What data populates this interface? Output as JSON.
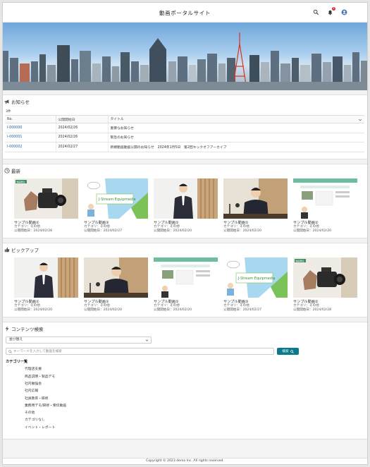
{
  "header": {
    "site_title": "動画ポータルサイト",
    "notif_count": "1",
    "icons": [
      "search-icon",
      "bell-icon",
      "user-icon"
    ]
  },
  "news": {
    "title": "お知らせ",
    "count": "3件",
    "columns": {
      "no": "No.",
      "date": "公開開始日",
      "title": "タイトル"
    },
    "rows": [
      {
        "no": "I-000000",
        "date": "2024/02/26",
        "title": "重要なお知らせ"
      },
      {
        "no": "I-000001",
        "date": "2024/02/26",
        "title": "緊急のお知らせ"
      },
      {
        "no": "I-000002",
        "date": "2024/02/27",
        "title": "新規動画動画公開のお知らせ　2024年1月5日　第2回キックオフアーカイブ"
      }
    ]
  },
  "latest": {
    "title": "最新",
    "items": [
      {
        "name": "サンプル動画②",
        "category": "カテゴリ：その他",
        "date": "公開開始日：2024/02/28"
      },
      {
        "name": "サンプル動画③",
        "category": "カテゴリ：その他",
        "date": "公開開始日：2024/02/27"
      },
      {
        "name": "サンプル動画①",
        "category": "カテゴリ：その他",
        "date": "公開開始日：2024/02/20"
      },
      {
        "name": "サンプル動画①",
        "category": "カテゴリ：その他",
        "date": "公開開始日：2024/02/20"
      },
      {
        "name": "サンプル動画①",
        "category": "カテゴリ：その他",
        "date": "公開開始日：2024/02/20"
      }
    ]
  },
  "pickup": {
    "title": "ピックアップ",
    "items": [
      {
        "name": "サンプル動画①",
        "category": "カテゴリ：その他",
        "date": "公開開始日：2024/02/20"
      },
      {
        "name": "サンプル動画①",
        "category": "カテゴリ：その他",
        "date": "公開開始日：2024/02/20"
      },
      {
        "name": "サンプル動画①",
        "category": "カテゴリ：その他",
        "date": "公開開始日：2024/02/20"
      },
      {
        "name": "サンプル動画③",
        "category": "カテゴリ：その他",
        "date": "公開開始日：2024/02/27"
      },
      {
        "name": "サンプル動画②",
        "category": "カテゴリ：その他",
        "date": "公開開始日：2024/02/28"
      }
    ]
  },
  "thumb_text": {
    "equipmedia": "J-Stream Equipmedia",
    "tag": "動画再生"
  },
  "search": {
    "title": "コンテンツ検索",
    "sort_value": "並び替え",
    "placeholder": "キーワードを入力して動画を検索",
    "button": "検索",
    "category_head": "カテゴリ一覧",
    "categories": [
      "代理店支援",
      "商品説明・製品デモ",
      "社内勉強会",
      "社内広報",
      "社員教育・研修",
      "業務用デモ/研修・要伝動画",
      "その他",
      "カテゴリなし",
      "イベント・レポート"
    ]
  },
  "footer": {
    "copyright": "Copyright © 2023 demo Inc. All rights reserved."
  },
  "colors": {
    "link": "#1d5fa6",
    "button": "#0c7a8d",
    "badge": "#dd3333"
  }
}
